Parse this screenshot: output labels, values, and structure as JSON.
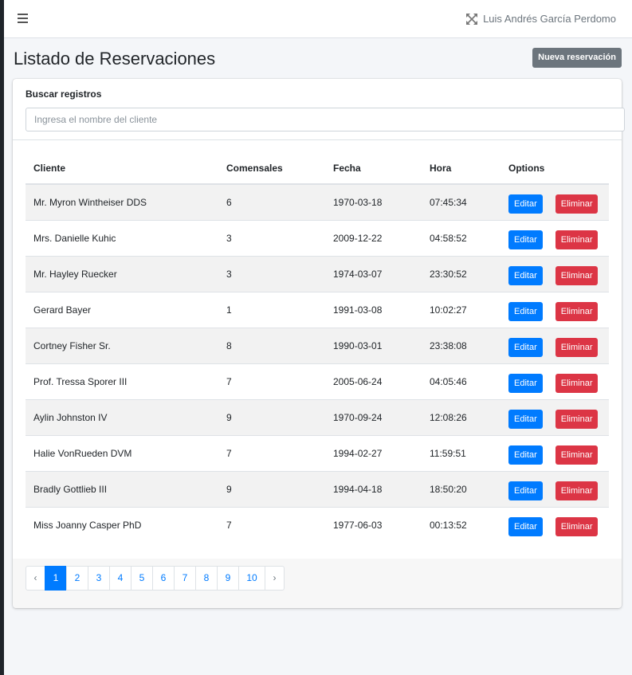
{
  "navbar": {
    "user_name": "Luis Andrés García Perdomo"
  },
  "page": {
    "title": "Listado de Reservaciones",
    "new_button": "Nueva reservación"
  },
  "search": {
    "label": "Buscar registros",
    "placeholder": "Ingresa el nombre del cliente",
    "value": ""
  },
  "table": {
    "headers": [
      "Cliente",
      "Comensales",
      "Fecha",
      "Hora",
      "Options"
    ],
    "rows": [
      {
        "cliente": "Mr. Myron Wintheiser DDS",
        "comensales": "6",
        "fecha": "1970-03-18",
        "hora": "07:45:34"
      },
      {
        "cliente": "Mrs. Danielle Kuhic",
        "comensales": "3",
        "fecha": "2009-12-22",
        "hora": "04:58:52"
      },
      {
        "cliente": "Mr. Hayley Ruecker",
        "comensales": "3",
        "fecha": "1974-03-07",
        "hora": "23:30:52"
      },
      {
        "cliente": "Gerard Bayer",
        "comensales": "1",
        "fecha": "1991-03-08",
        "hora": "10:02:27"
      },
      {
        "cliente": "Cortney Fisher Sr.",
        "comensales": "8",
        "fecha": "1990-03-01",
        "hora": "23:38:08"
      },
      {
        "cliente": "Prof. Tressa Sporer III",
        "comensales": "7",
        "fecha": "2005-06-24",
        "hora": "04:05:46"
      },
      {
        "cliente": "Aylin Johnston IV",
        "comensales": "9",
        "fecha": "1970-09-24",
        "hora": "12:08:26"
      },
      {
        "cliente": "Halie VonRueden DVM",
        "comensales": "7",
        "fecha": "1994-02-27",
        "hora": "11:59:51"
      },
      {
        "cliente": "Bradly Gottlieb III",
        "comensales": "9",
        "fecha": "1994-04-18",
        "hora": "18:50:20"
      },
      {
        "cliente": "Miss Joanny Casper PhD",
        "comensales": "7",
        "fecha": "1977-06-03",
        "hora": "00:13:52"
      }
    ],
    "edit_label": "Editar",
    "delete_label": "Eliminar"
  },
  "pagination": {
    "prev": "‹",
    "next": "›",
    "pages": [
      "1",
      "2",
      "3",
      "4",
      "5",
      "6",
      "7",
      "8",
      "9",
      "10"
    ],
    "current": "1"
  },
  "colors": {
    "primary": "#007bff",
    "danger": "#dc3545",
    "secondary": "#6c757d"
  },
  "icons": {
    "menu": "hamburger-icon",
    "fullscreen": "expand-arrows-icon"
  }
}
